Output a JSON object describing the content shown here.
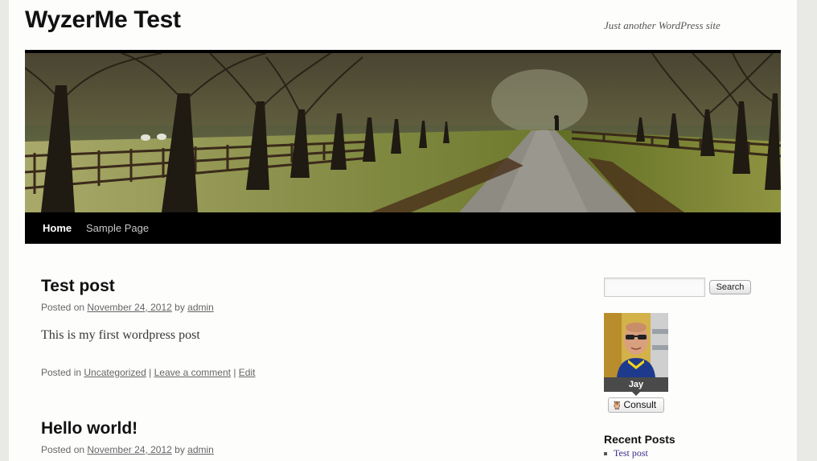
{
  "site": {
    "title": "WyzerMe Test",
    "description": "Just another WordPress site"
  },
  "nav": {
    "items": [
      {
        "label": "Home",
        "active": true
      },
      {
        "label": "Sample Page",
        "active": false
      }
    ]
  },
  "posts": [
    {
      "title": "Test post",
      "posted_on": "Posted on",
      "date": "November 24, 2012",
      "by": "by",
      "author": "admin",
      "content": "This is my first wordpress post",
      "footer": {
        "posted_in": "Posted in",
        "category": "Uncategorized",
        "sep1": "|",
        "comment_link": "Leave a comment",
        "sep2": "|",
        "edit_link": "Edit"
      }
    },
    {
      "title": "Hello world!",
      "posted_on": "Posted on",
      "date": "November 24, 2012",
      "by": "by",
      "author": "admin"
    }
  ],
  "sidebar": {
    "search_button": "Search",
    "search_value": "",
    "avatar_name": "Jay",
    "consult_label": "Consult",
    "recent_posts_title": "Recent Posts",
    "recent_posts": [
      "Test post"
    ]
  },
  "colors": {
    "nav_background": "#000000",
    "link_recent": "#3b2b8a",
    "page_background": "#fdfdfc"
  }
}
